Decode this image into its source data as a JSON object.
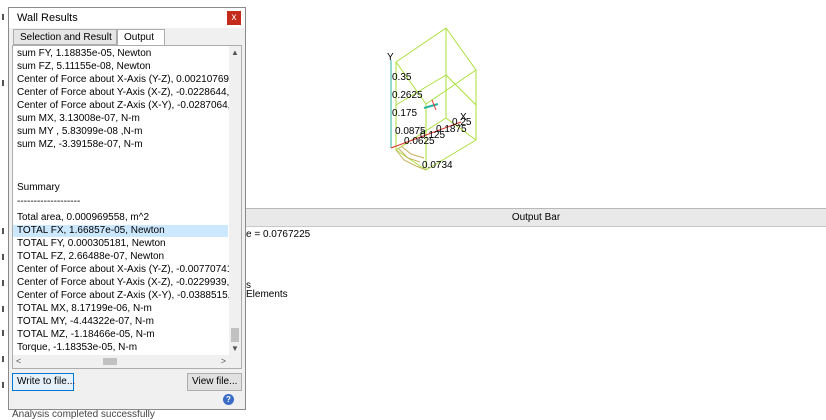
{
  "dialog": {
    "title": "Wall Results",
    "close_glyph": "x",
    "tabs": [
      {
        "label": "Selection and Result",
        "active": false
      },
      {
        "label": "Output",
        "active": true
      }
    ],
    "lines_top": [
      "sum FY, 1.18835e-05, Newton",
      "sum FZ, 5.11155e-08, Newton",
      "Center of Force about X-Axis (Y-Z), 0.00210769, -(",
      "Center of Force about Y-Axis (X-Z), -0.0228644, -(",
      "Center of Force about Z-Axis (X-Y), -0.0287064, 0.",
      "sum MX, 3.13008e-07, N-m",
      "sum MY , 5.83099e-08 ,N-m",
      "sum MZ, -3.39158e-07, N-m"
    ],
    "summary_title": "Summary",
    "summary_rule": "-------------------",
    "lines_summary": [
      "Total area, 0.000969558, m^2",
      "TOTAL FX, 1.66857e-05, Newton",
      "TOTAL FY, 0.000305181, Newton",
      "TOTAL FZ, 2.66488e-07, Newton",
      "Center of Force about X-Axis (Y-Z), -0.00770741, -",
      "Center of Force about Y-Axis (X-Z), -0.0229939, -0",
      "Center of Force about Z-Axis (X-Y), -0.0388515, -0",
      "TOTAL MX, 8.17199e-06, N-m",
      "TOTAL MY, -4.44322e-07, N-m",
      "TOTAL MZ, -1.18466e-05, N-m",
      "Torque, -1.18353e-05, N-m"
    ],
    "highlighted_line": "TOTAL FX, 1.66857e-05, Newton",
    "write_button": "Write to file...",
    "view_button": "View file...",
    "help_glyph": "?"
  },
  "viewport": {
    "axis_y_label": "Y",
    "axis_x_label": "X",
    "ticks": [
      "0.35",
      "0.2625",
      "0.175",
      "0.0875",
      "0.0625",
      "0.125",
      "0.1875",
      "0.25",
      "0.0734"
    ]
  },
  "output_bar": {
    "title": "Output Bar",
    "line1": "e = 0.0767225",
    "line2": "s",
    "line3": "Elements"
  },
  "status": {
    "text": "Analysis completed successfully"
  },
  "colors": {
    "highlight": "#cce8ff",
    "close": "#c42b1c",
    "wireframe": "#a8e03a",
    "axis_x": "#e03030",
    "axis_y": "#2bb5a0"
  }
}
